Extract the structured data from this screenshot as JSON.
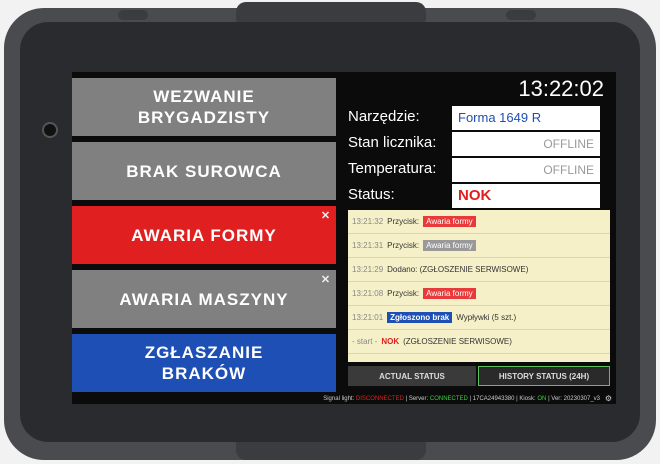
{
  "clock": "13:22:02",
  "buttons": {
    "wezwanie": "WEZWANIE\nBRYGADZISTY",
    "brak_surowca": "BRAK SUROWCA",
    "awaria_formy": "AWARIA FORMY",
    "awaria_maszyny": "AWARIA MASZYNY",
    "zglaszanie": "ZGŁASZANIE\nBRAKÓW"
  },
  "fields": {
    "narzedzie_label": "Narzędzie:",
    "narzedzie_value": "Forma 1649 R",
    "licznik_label": "Stan licznika:",
    "licznik_value": "OFFLINE",
    "temperatura_label": "Temperatura:",
    "temperatura_value": "OFFLINE",
    "status_label": "Status:",
    "status_value": "NOK"
  },
  "log": [
    {
      "time": "13:21:32",
      "text": "Przycisk:",
      "tag": "Awaria formy",
      "tag_color": "red"
    },
    {
      "time": "13:21:31",
      "text": "Przycisk:",
      "tag": "Awaria formy",
      "tag_color": "gray"
    },
    {
      "time": "13:21:29",
      "text": "Dodano: (ZGŁOSZENIE SERWISOWE)"
    },
    {
      "time": "13:21:08",
      "text": "Przycisk:",
      "tag": "Awaria formy",
      "tag_color": "red"
    },
    {
      "time": "13:21:01",
      "tag_first": "Zgłoszono brak",
      "text_after": "Wypływki (5 szt.)"
    },
    {
      "time": "- start -",
      "nok": "NOK",
      "text_after": "(ZGŁOSZENIE SERWISOWE)"
    }
  ],
  "tabs": {
    "actual": "ACTUAL STATUS",
    "history": "HISTORY STATUS (24H)"
  },
  "footer": {
    "signal_label": "Signal light:",
    "signal_value": "DISCONNECTED",
    "server_label": "| Server:",
    "server_value": "CONNECTED",
    "id": "| 17CA24943380 | Kiosk:",
    "kiosk_value": "ON",
    "version": "| Ver: 20230307_v3"
  },
  "colors": {
    "red": "#e02020",
    "blue": "#1e4fb5",
    "gray": "#808080",
    "log_bg": "#f5f0c8"
  }
}
